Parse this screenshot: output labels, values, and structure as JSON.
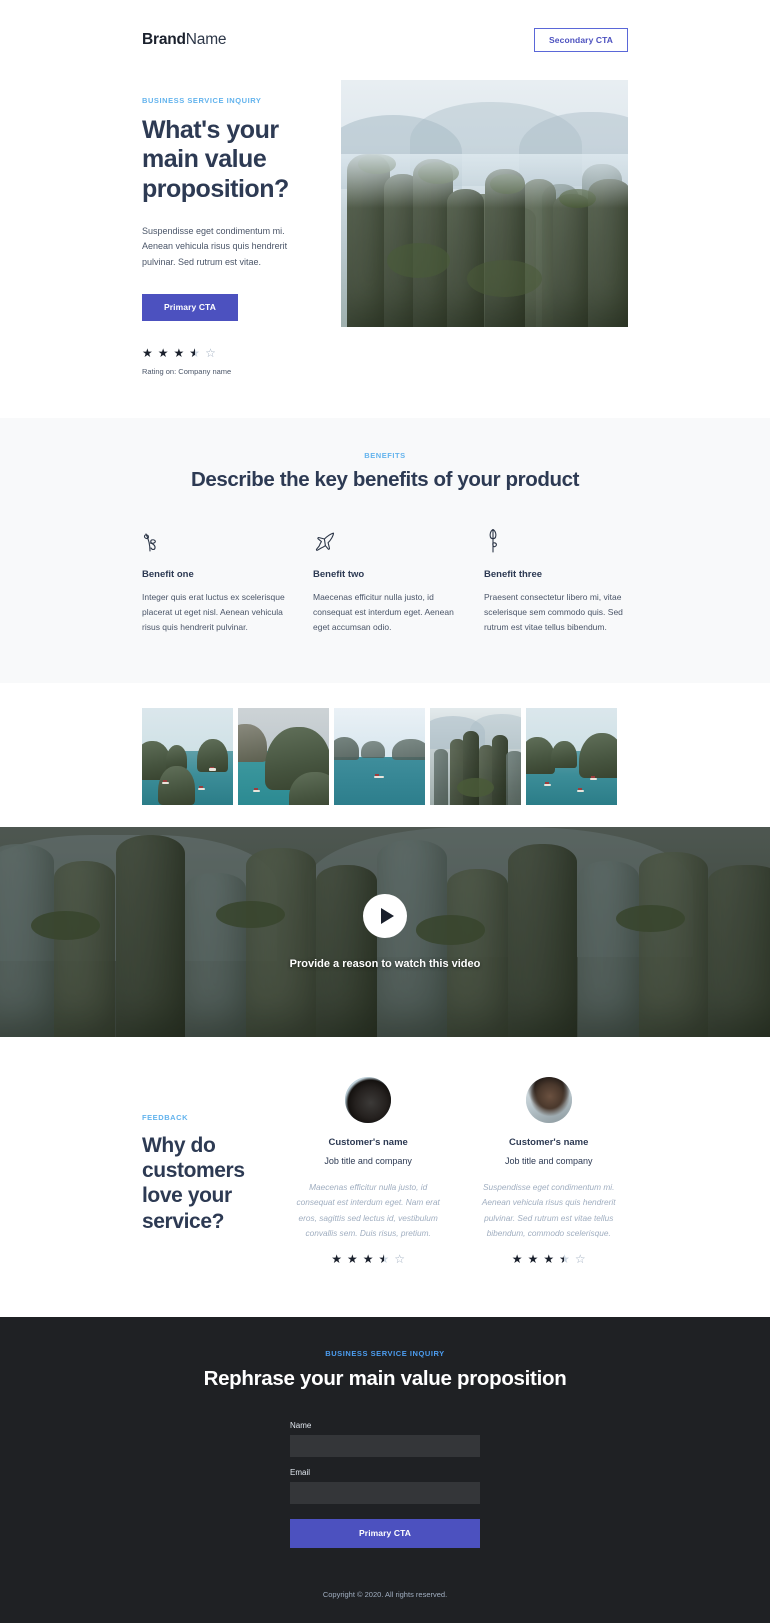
{
  "header": {
    "brand_bold": "Brand",
    "brand_light": "Name",
    "secondary_cta": "Secondary CTA"
  },
  "hero": {
    "eyebrow": "BUSINESS SERVICE INQUIRY",
    "title": "What's your main value proposition?",
    "body": "Suspendisse eget condimentum mi. Aenean vehicula risus quis hendrerit pulvinar. Sed rutrum est vitae.",
    "primary_cta": "Primary CTA",
    "rating_caption": "Rating on: Company name",
    "rating_value": 3.5,
    "rating_max": 5
  },
  "benefits": {
    "eyebrow": "BENEFITS",
    "title": "Describe the key benefits of your product",
    "items": [
      {
        "icon": "sprout-icon",
        "title": "Benefit one",
        "text": "Integer quis erat luctus ex scelerisque placerat ut eget nisl. Aenean vehicula risus quis hendrerit pulvinar."
      },
      {
        "icon": "paper-plane-icon",
        "title": "Benefit two",
        "text": "Maecenas efficitur nulla justo, id consequat est interdum eget. Aenean eget accumsan odio."
      },
      {
        "icon": "flower-icon",
        "title": "Benefit three",
        "text": "Praesent consectetur libero mi, vitae scelerisque sem commodo quis. Sed rutrum est vitae tellus bibendum."
      }
    ]
  },
  "gallery": {
    "items": [
      {
        "alt": "halong-bay-boats"
      },
      {
        "alt": "limestone-island-lagoon"
      },
      {
        "alt": "misty-bay-single-boat"
      },
      {
        "alt": "karst-pillars-forest"
      },
      {
        "alt": "halong-bay-junks"
      }
    ]
  },
  "video": {
    "caption": "Provide a reason to watch this video",
    "play_icon": "play-icon"
  },
  "testimonials": {
    "eyebrow": "FEEDBACK",
    "title": "Why do customers love your service?",
    "cards": [
      {
        "name": "Customer's name",
        "job": "Job title and company",
        "quote": "Maecenas efficitur nulla justo, id consequat est interdum eget. Nam erat eros, sagittis sed lectus id, vestibulum convallis sem. Duis risus, pretium.",
        "rating_value": 3.5,
        "rating_max": 5
      },
      {
        "name": "Customer's name",
        "job": "Job title and company",
        "quote": "Suspendisse eget condimentum mi. Aenean vehicula risus quis hendrerit pulvinar. Sed rutrum est vitae tellus bibendum, commodo scelerisque.",
        "rating_value": 3.5,
        "rating_max": 5
      }
    ]
  },
  "footer_cta": {
    "eyebrow": "BUSINESS SERVICE INQUIRY",
    "title": "Rephrase your main value proposition",
    "name_label": "Name",
    "name_value": "",
    "name_placeholder": "",
    "email_label": "Email",
    "email_value": "",
    "email_placeholder": "",
    "submit_label": "Primary CTA",
    "copyright": "Copyright © 2020. All rights reserved."
  },
  "colors": {
    "accent_indigo": "#4c51bf",
    "eyebrow_blue": "#63b3ed",
    "footer_eyebrow_blue": "#4c9df0",
    "heading_navy": "#2d3a53",
    "body_gray": "#4a5568",
    "benefits_bg": "#f8f9fa",
    "footer_bg": "#1f2124",
    "field_bg": "#343639"
  }
}
